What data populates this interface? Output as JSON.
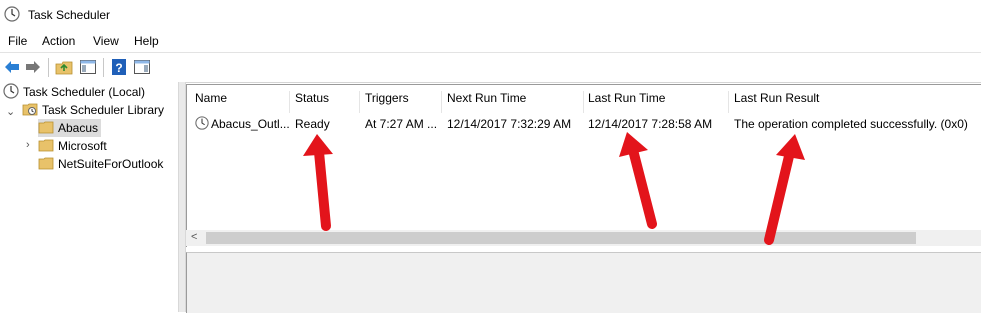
{
  "window": {
    "title": "Task Scheduler"
  },
  "menu": {
    "file": "File",
    "action": "Action",
    "view": "View",
    "help": "Help"
  },
  "toolbar": {
    "icons": [
      "back-arrow-icon",
      "forward-arrow-icon",
      "up-folder-icon",
      "show-hide-console-tree-icon",
      "help-icon",
      "show-hide-action-pane-icon"
    ]
  },
  "tree": {
    "root": "Task Scheduler (Local)",
    "library": "Task Scheduler Library",
    "children": [
      "Abacus",
      "Microsoft",
      "NetSuiteForOutlook"
    ]
  },
  "table": {
    "headers": {
      "name": "Name",
      "status": "Status",
      "triggers": "Triggers",
      "next_run": "Next Run Time",
      "last_run": "Last Run Time",
      "last_result": "Last Run Result"
    },
    "rows": [
      {
        "name": "Abacus_Outl...",
        "status": "Ready",
        "triggers": "At 7:27 AM ...",
        "next_run": "12/14/2017 7:32:29 AM",
        "last_run": "12/14/2017 7:28:58 AM",
        "last_result": "The operation completed successfully. (0x0)"
      }
    ]
  },
  "colors": {
    "annotation_arrow": "#e3141b",
    "folder": "#e8c26a",
    "selection": "#dcdcdc"
  }
}
